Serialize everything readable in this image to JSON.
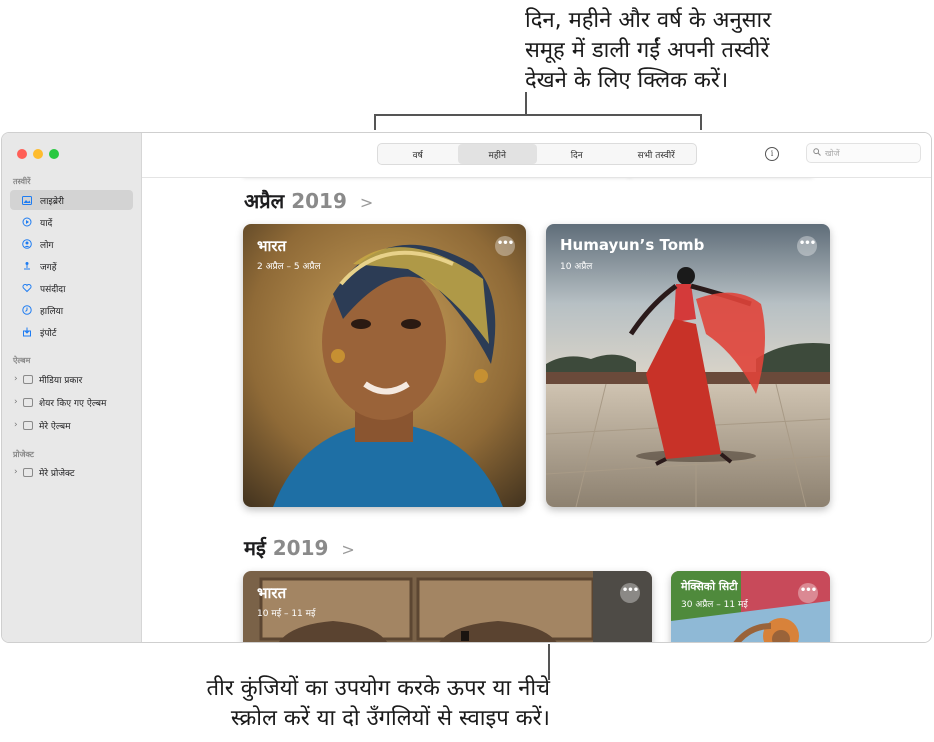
{
  "callouts": {
    "top_line1": "दिन, महीने और वर्ष के अनुसार",
    "top_line2": "समूह में डाली गईं अपनी तस्वीरें",
    "top_line3": "देखने के लिए क्लिक करें।",
    "bottom_line1": "तीर कुंजियों का उपयोग करके ऊपर या नीचे",
    "bottom_line2": "स्क्रोल करें या दो उँगलियों से स्वाइप करें।"
  },
  "sidebar": {
    "section_photos": "तस्वीरें",
    "items": [
      {
        "label": "लाइब्रेरी",
        "icon": "library-icon"
      },
      {
        "label": "यादें",
        "icon": "memories-icon"
      },
      {
        "label": "लोग",
        "icon": "people-icon"
      },
      {
        "label": "जगहें",
        "icon": "places-icon"
      },
      {
        "label": "पसंदीदा",
        "icon": "heart-icon"
      },
      {
        "label": "हालिया",
        "icon": "recents-icon"
      },
      {
        "label": "इंपोर्ट",
        "icon": "import-icon"
      }
    ],
    "section_albums": "ऐल्बम",
    "albums": [
      {
        "label": "मीडिया प्रकार"
      },
      {
        "label": "शेयर किए गए ऐल्बम"
      },
      {
        "label": "मेरे ऐल्बम"
      }
    ],
    "section_projects": "प्रोजेक्ट",
    "projects": [
      {
        "label": "मेरे प्रोजेक्ट"
      }
    ]
  },
  "toolbar": {
    "tabs": [
      "वर्ष",
      "महीने",
      "दिन",
      "सभी तस्वीरें"
    ],
    "selected_tab": "महीने",
    "info_label": "i",
    "search_placeholder": "खोजें"
  },
  "months": [
    {
      "month": "अप्रैल",
      "year": "2019",
      "cards": [
        {
          "title": "भारत",
          "date": "2 अप्रैल – 5 अप्रैल"
        },
        {
          "title": "Humayun’s Tomb",
          "date": "10 अप्रैल"
        }
      ]
    },
    {
      "month": "मई",
      "year": "2019",
      "cards": [
        {
          "title": "भारत",
          "date": "10 मई – 11 मई"
        },
        {
          "title": "मेक्सिको सिटी",
          "date": "30 अप्रैल – 11 मई"
        }
      ]
    }
  ],
  "more_label": "•••",
  "chevron": ">",
  "colors": {
    "sidebar_bg": "#e8e8e8",
    "accent": "#1e7cf2",
    "red": "#ff5f57",
    "yellow": "#febc2e",
    "green": "#28c840"
  }
}
